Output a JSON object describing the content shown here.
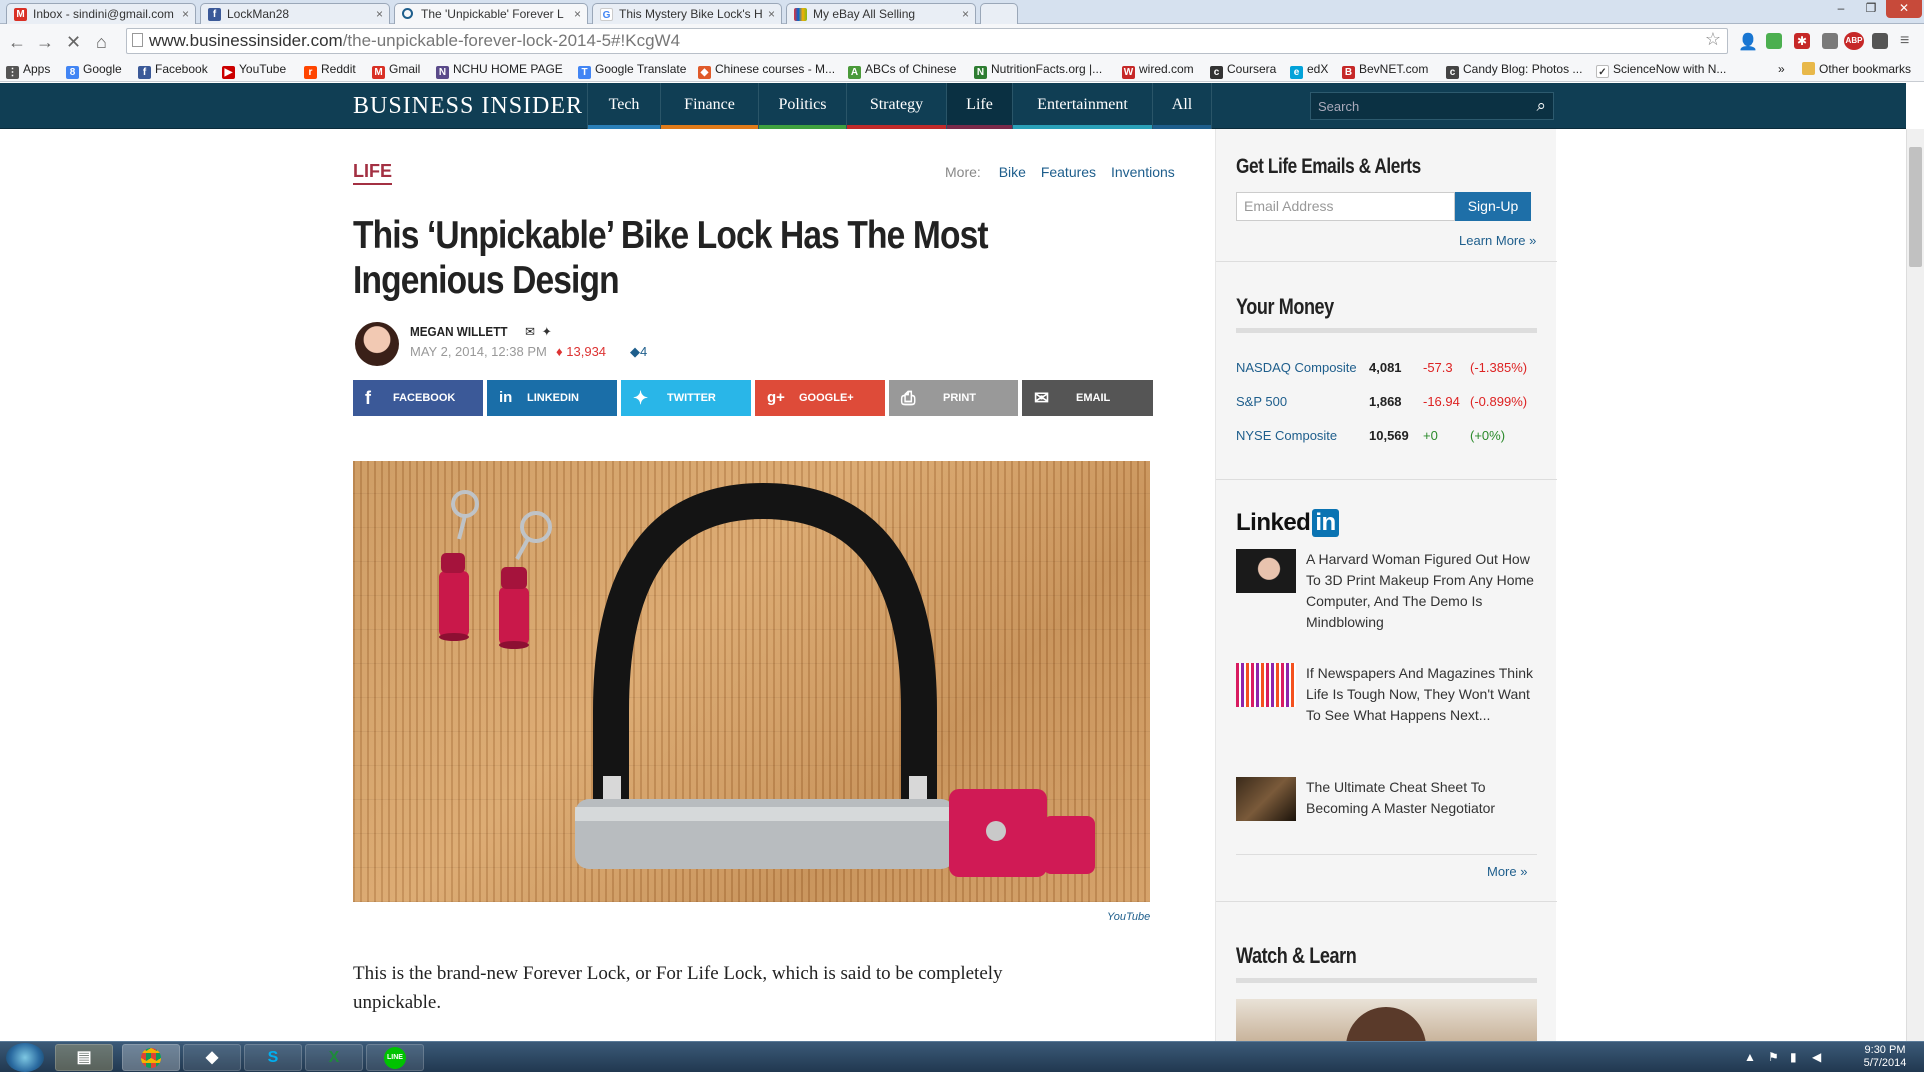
{
  "browser": {
    "tabs": [
      {
        "title": "Inbox - sindini@gmail.com",
        "icon": "gmail-icon",
        "color": "#d93025"
      },
      {
        "title": "LockMan28",
        "icon": "facebook-icon",
        "color": "#3b5998"
      },
      {
        "title": "The 'Unpickable' Forever L",
        "icon": "loading-icon",
        "color": "#1e5e8c"
      },
      {
        "title": "This Mystery Bike Lock's H",
        "icon": "google-icon",
        "color": "#4285f4"
      },
      {
        "title": "My eBay All Selling",
        "icon": "ebay-icon",
        "color": "#e53238"
      }
    ],
    "url_domain": "www.businessinsider.com",
    "url_path": "/the-unpickable-forever-lock-2014-5#!KcgW4",
    "bookmarks": [
      "Apps",
      "Google",
      "Facebook",
      "YouTube",
      "Reddit",
      "Gmail",
      "NCHU HOME PAGE",
      "Google Translate",
      "Chinese courses - M...",
      "ABCs of Chinese",
      "NutritionFacts.org |...",
      "wired.com",
      "Coursera",
      "edX",
      "BevNET.com",
      "Candy Blog: Photos ...",
      "ScienceNow with N...",
      "»",
      "Other bookmarks"
    ]
  },
  "site": {
    "logo": "BUSINESS INSIDER",
    "nav": [
      {
        "label": "Tech",
        "color": "#2a7fb8"
      },
      {
        "label": "Finance",
        "color": "#e07b1a"
      },
      {
        "label": "Politics",
        "color": "#3fa03f"
      },
      {
        "label": "Strategy",
        "color": "#c02a2a"
      },
      {
        "label": "Life",
        "color": "#7a2a4a"
      },
      {
        "label": "Entertainment",
        "color": "#2aa0b8"
      },
      {
        "label": "All",
        "color": "#1e5e8c"
      }
    ],
    "search_placeholder": "Search"
  },
  "article": {
    "section": "LIFE",
    "more_label": "More:",
    "more_tags": [
      "Bike",
      "Features",
      "Inventions"
    ],
    "headline": "This ‘Unpickable’ Bike Lock Has The Most Ingenious Design",
    "author": "MEGAN WILLETT",
    "date": "MAY 2, 2014, 12:38 PM",
    "views": "13,934",
    "comments": "4",
    "share": [
      {
        "label": "FACEBOOK",
        "color": "#3b5998",
        "icon": "f"
      },
      {
        "label": "LINKEDIN",
        "color": "#1a6ea8",
        "icon": "in"
      },
      {
        "label": "TWITTER",
        "color": "#29b6e8",
        "icon": "✦"
      },
      {
        "label": "GOOGLE+",
        "color": "#de4b39",
        "icon": "g+"
      },
      {
        "label": "PRINT",
        "color": "#999999",
        "icon": "⎙"
      },
      {
        "label": "EMAIL",
        "color": "#555555",
        "icon": "✉"
      }
    ],
    "image_credit": "YouTube",
    "paragraph": "This is the brand-new Forever Lock, or For Life Lock, which is said to be completely unpickable."
  },
  "sidebar": {
    "alerts_title": "Get Life Emails & Alerts",
    "email_placeholder": "Email Address",
    "signup_label": "Sign-Up",
    "learn_more": "Learn More »",
    "money_title": "Your Money",
    "markets": [
      {
        "name": "NASDAQ Composite",
        "value": "4,081",
        "change": "-57.3",
        "pct": "(-1.385%)",
        "dir": "neg"
      },
      {
        "name": "S&P 500",
        "value": "1,868",
        "change": "-16.94",
        "pct": "(-0.899%)",
        "dir": "neg"
      },
      {
        "name": "NYSE Composite",
        "value": "10,569",
        "change": "+0",
        "pct": "(+0%)",
        "dir": "pos"
      }
    ],
    "linkedin_logo_text": "Linked",
    "linkedin_logo_in": "in",
    "linkedin_items": [
      "A Harvard Woman Figured Out How To 3D Print Makeup From Any Home Computer, And The Demo Is Mindblowing",
      "If Newspapers And Magazines Think Life Is Tough Now, They Won't Want To See What Happens Next...",
      "The Ultimate Cheat Sheet To Becoming A Master Negotiator"
    ],
    "more_link": "More »",
    "watch_title": "Watch & Learn"
  },
  "taskbar": {
    "time": "9:30 PM",
    "date": "5/7/2014"
  }
}
